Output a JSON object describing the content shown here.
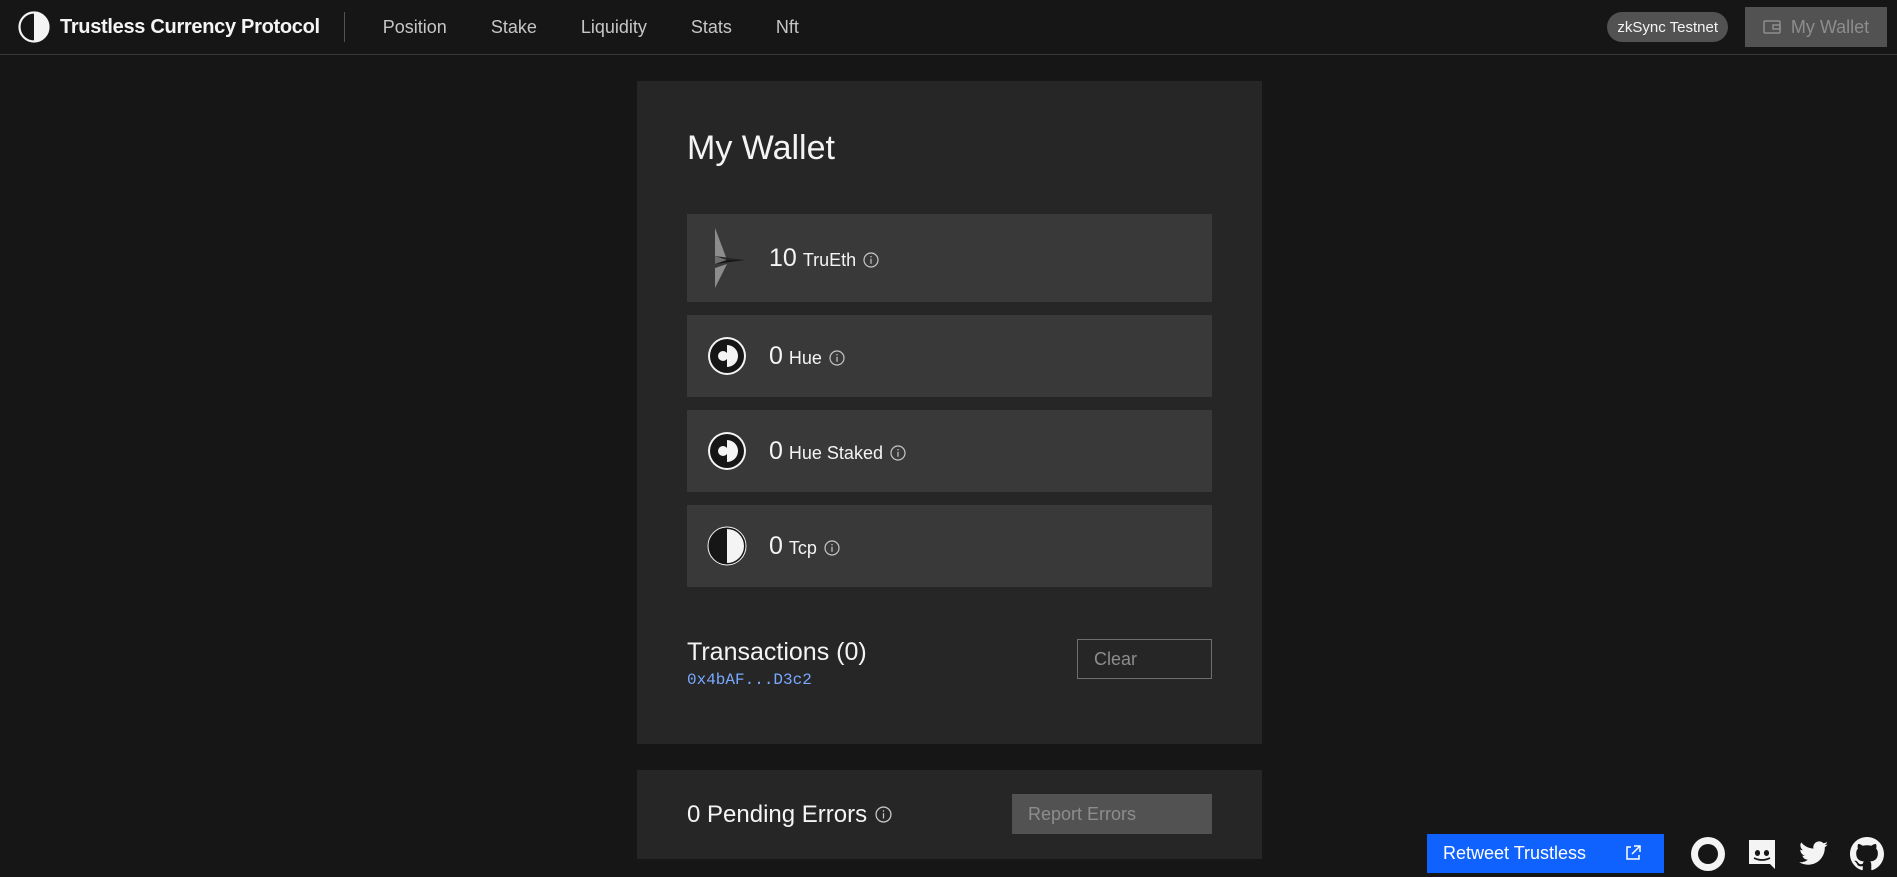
{
  "header": {
    "brand": "Trustless Currency Protocol",
    "nav": [
      "Position",
      "Stake",
      "Liquidity",
      "Stats",
      "Nft"
    ],
    "network": "zkSync Testnet",
    "wallet_button": "My Wallet"
  },
  "wallet": {
    "title": "My Wallet",
    "tokens": [
      {
        "amount": "10",
        "name": "TruEth",
        "icon": "ethereum-icon"
      },
      {
        "amount": "0",
        "name": "Hue",
        "icon": "hue-icon"
      },
      {
        "amount": "0",
        "name": "Hue Staked",
        "icon": "hue-icon"
      },
      {
        "amount": "0",
        "name": "Tcp",
        "icon": "tcp-icon"
      }
    ],
    "transactions_title": "Transactions (0)",
    "address": "0x4bAF...D3c2",
    "clear_label": "Clear"
  },
  "errors": {
    "text": "0 Pending Errors",
    "report_label": "Report Errors"
  },
  "footer": {
    "retweet_label": "Retweet Trustless",
    "social": [
      "tcp-icon",
      "discord-icon",
      "twitter-icon",
      "github-icon"
    ]
  }
}
